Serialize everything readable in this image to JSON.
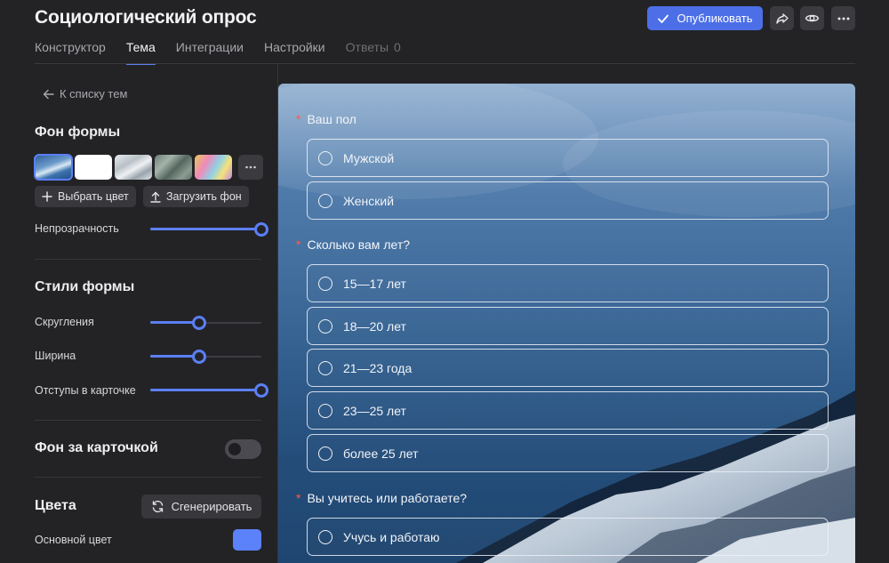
{
  "header": {
    "title": "Социологический опрос",
    "publish_label": "Опубликовать",
    "tabs": [
      {
        "label": "Конструктор"
      },
      {
        "label": "Тема"
      },
      {
        "label": "Интеграции"
      },
      {
        "label": "Настройки"
      },
      {
        "label": "Ответы",
        "count": "0"
      }
    ],
    "active_tab": "Тема",
    "icons": [
      "share-icon",
      "eye-icon",
      "more-icon"
    ]
  },
  "sidebar": {
    "back_label": "К списку тем",
    "bg_section": {
      "title": "Фон формы",
      "thumbnails": [
        "sea-wave",
        "white",
        "snow-texture",
        "green-texture",
        "colorful-paint"
      ],
      "selected_thumbnail": "sea-wave",
      "choose_color_label": "Выбрать цвет",
      "upload_label": "Загрузить фон",
      "opacity_label": "Непрозрачность",
      "opacity_value": 1.0
    },
    "styles_section": {
      "title": "Стили формы",
      "rounding_label": "Скругления",
      "rounding_value": 0.4,
      "width_label": "Ширина",
      "width_value": 0.4,
      "padding_label": "Отступы в карточке",
      "padding_value": 1.0
    },
    "card_bg": {
      "title": "Фон за карточкой",
      "enabled": false
    },
    "colors": {
      "title": "Цвета",
      "generate_label": "Сгенерировать",
      "primary_label": "Основной цвет",
      "primary_color": "#5b82fb"
    }
  },
  "preview": {
    "questions": [
      {
        "text": "Ваш пол",
        "required": "*",
        "options": [
          "Мужской",
          "Женский"
        ]
      },
      {
        "text": "Сколько вам лет?",
        "required": "*",
        "options": [
          "15—17 лет",
          "18—20 лет",
          "21—23 года",
          "23—25 лет",
          "более 25 лет"
        ]
      },
      {
        "text": "Вы учитесь или работаете?",
        "required": "*",
        "options": [
          "Учусь и работаю"
        ]
      }
    ]
  },
  "colors": {
    "accent": "#5b7ff5",
    "publish_button": "#4c6fe8",
    "background": "#232326",
    "required_marker": "#ff5b4a"
  }
}
